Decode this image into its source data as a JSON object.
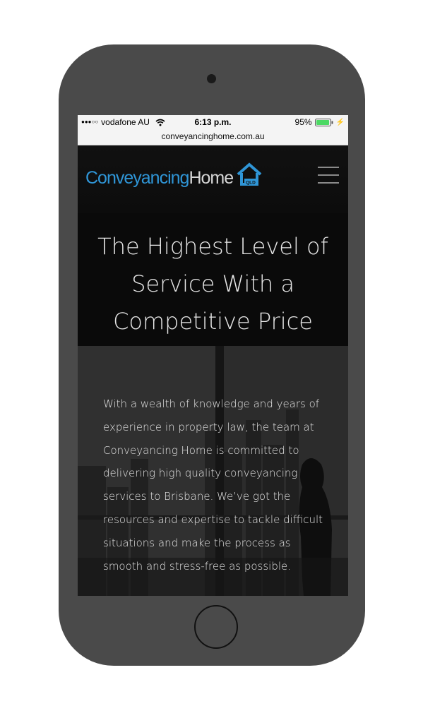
{
  "status_bar": {
    "signal": "●●●○○",
    "carrier": "vodafone AU",
    "time": "6:13 p.m.",
    "battery": "95%",
    "battery_level": 0.95,
    "battery_color": "#4cd964"
  },
  "browser": {
    "url": "conveyancinghome.com.au"
  },
  "header": {
    "logo_part1": "Conveyancing",
    "logo_part2": "Home",
    "logo_badge": "QLD",
    "brand_blue": "#2f95d6"
  },
  "hero": {
    "title": "The Highest Level of Service With a Competitive Price"
  },
  "intro": {
    "text": "With a wealth of knowledge and years of experience in property law, the team at Conveyancing Home is committed to delivering high quality conveyancing services to Brisbane. We’ve got the resources and expertise to tackle difficult situations and make the process as smooth and stress-free as possible."
  }
}
